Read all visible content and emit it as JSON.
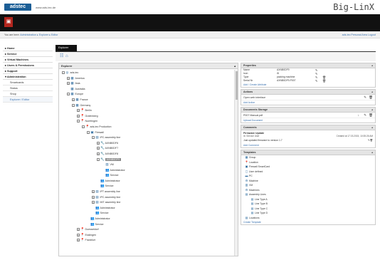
{
  "header": {
    "logo": "adstec",
    "site_url": "www.ads-tec.de",
    "brand": "Big-LinX"
  },
  "breadcrumb": {
    "prefix": "You are here:",
    "path": "Administration ▸ Explorer ▸ Editor",
    "user_links": "ads-tec   Personal Area   Logout"
  },
  "sidebar": {
    "items": [
      {
        "label": "▸ Home"
      },
      {
        "label": "▸ Service"
      },
      {
        "label": "▸ Virtual Machines"
      },
      {
        "label": "▸ Users & Permissions"
      },
      {
        "label": "▸ Support"
      },
      {
        "label": "▾ Administration"
      }
    ],
    "subitems": [
      {
        "label": "Smartcards"
      },
      {
        "label": "Status"
      },
      {
        "label": "Shop"
      },
      {
        "label": "Explorer / Editor"
      }
    ]
  },
  "main": {
    "tab_label": "Explorer",
    "explorer_title": "Explorer"
  },
  "tree": [
    {
      "label": "ads-tec",
      "level": 0,
      "icon": "globe",
      "exp": "−"
    },
    {
      "label": "America",
      "level": 1,
      "icon": "building",
      "exp": "+"
    },
    {
      "label": "Asia",
      "level": 1,
      "icon": "building",
      "exp": "+"
    },
    {
      "label": "Australia",
      "level": 1,
      "icon": "building",
      "exp": ""
    },
    {
      "label": "Europe",
      "level": 1,
      "icon": "building",
      "exp": "−"
    },
    {
      "label": "France",
      "level": 2,
      "icon": "building",
      "exp": "+"
    },
    {
      "label": "Germany",
      "level": 2,
      "icon": "building",
      "exp": "−"
    },
    {
      "label": "Berlin",
      "level": 3,
      "icon": "pin",
      "exp": "+"
    },
    {
      "label": "Grafenberg",
      "level": 3,
      "icon": "pin",
      "exp": "+"
    },
    {
      "label": "Nuertingen",
      "level": 3,
      "icon": "pin",
      "exp": "−"
    },
    {
      "label": "ads-tec Production",
      "level": 4,
      "icon": "pin",
      "exp": "−"
    },
    {
      "label": "Firewall",
      "level": 5,
      "icon": "firewall",
      "exp": "−"
    },
    {
      "label": "IPC assembly line",
      "level": 6,
      "icon": "ipc",
      "exp": "−"
    },
    {
      "label": "AXNB0DF6",
      "level": 7,
      "icon": "device",
      "exp": "+"
    },
    {
      "label": "AXNB0DF7",
      "level": 7,
      "icon": "device",
      "exp": "+"
    },
    {
      "label": "AXNB0DF8",
      "level": 7,
      "icon": "device",
      "exp": "+"
    },
    {
      "label": "AXNB0DF9",
      "level": 7,
      "icon": "device",
      "exp": "−",
      "selected": true
    },
    {
      "label": "VM",
      "level": 8,
      "icon": "vm",
      "exp": ""
    },
    {
      "label": "Administrator",
      "level": 8,
      "icon": "people",
      "exp": ""
    },
    {
      "label": "Service",
      "level": 8,
      "icon": "people",
      "exp": ""
    },
    {
      "label": "Administrator",
      "level": 7,
      "icon": "people",
      "exp": ""
    },
    {
      "label": "Service",
      "level": 7,
      "icon": "people",
      "exp": ""
    },
    {
      "label": "IPT assembly line",
      "level": 6,
      "icon": "ipc",
      "exp": "+"
    },
    {
      "label": "IPC assembly line",
      "level": 6,
      "icon": "ipc",
      "exp": "+"
    },
    {
      "label": "MIT assembly line",
      "level": 6,
      "icon": "ipc",
      "exp": "+"
    },
    {
      "label": "Administrator",
      "level": 6,
      "icon": "people",
      "exp": ""
    },
    {
      "label": "Service",
      "level": 6,
      "icon": "people",
      "exp": ""
    },
    {
      "label": "Administrator",
      "level": 5,
      "icon": "people",
      "exp": ""
    },
    {
      "label": "Service",
      "level": 5,
      "icon": "people",
      "exp": ""
    },
    {
      "label": "Duesseldorf",
      "level": 3,
      "icon": "pin",
      "exp": "+"
    },
    {
      "label": "Esslingen",
      "level": 3,
      "icon": "pin",
      "exp": "+"
    },
    {
      "label": "Frankfurt",
      "level": 3,
      "icon": "pin",
      "exp": "+"
    }
  ],
  "properties": {
    "title": "Properties",
    "rows": [
      {
        "key": "Name",
        "value": "AXNB0DF9"
      },
      {
        "key": "Icon",
        "value": "⚙"
      },
      {
        "key": "Type",
        "value": "packing machine"
      },
      {
        "key": "Serial Nr",
        "value": "AXNB0DF9-P007"
      }
    ],
    "link": "Add / Create Attribute"
  },
  "actions": {
    "title": "Actions",
    "rows": [
      {
        "label": "Open web interface"
      }
    ],
    "link": "Add Action"
  },
  "documents": {
    "title": "Documents Storage",
    "rows": [
      {
        "label": "P007 Manual.pdf"
      }
    ],
    "link": "Upload Document"
  },
  "comments": {
    "title": "Comments",
    "entry_title": "Firmware Update",
    "author": "ib: Service User",
    "date": "Created at 17.03.2015, 10:35:26 AM",
    "text": "Just updated firmware to version 1.7",
    "link": "Add Comment"
  },
  "templates": {
    "title": "Templates",
    "rows": [
      {
        "label": "Group",
        "icon": "grp",
        "indent": 0
      },
      {
        "label": "Location",
        "icon": "pin",
        "indent": 0
      },
      {
        "label": "Firewall SmartCard",
        "icon": "fw",
        "indent": 0
      },
      {
        "label": "User defined",
        "icon": "user",
        "indent": 0
      },
      {
        "label": "PC",
        "icon": "pc",
        "indent": 0
      },
      {
        "label": "Machine",
        "icon": "machine",
        "indent": 0
      },
      {
        "label": "VM",
        "icon": "vm",
        "indent": 0
      },
      {
        "label": "Machines",
        "icon": "machine",
        "indent": 0
      },
      {
        "label": "Assembly Lines",
        "icon": "ipc",
        "indent": 0
      },
      {
        "label": "Line Type A",
        "icon": "ipc",
        "indent": 1
      },
      {
        "label": "Line Type B",
        "icon": "ipc",
        "indent": 1
      },
      {
        "label": "Line Type C",
        "icon": "ipc",
        "indent": 1
      },
      {
        "label": "Line Type D",
        "icon": "ipc",
        "indent": 1
      },
      {
        "label": "Locations",
        "icon": "ipc",
        "indent": 0
      }
    ],
    "link": "Create Template"
  }
}
